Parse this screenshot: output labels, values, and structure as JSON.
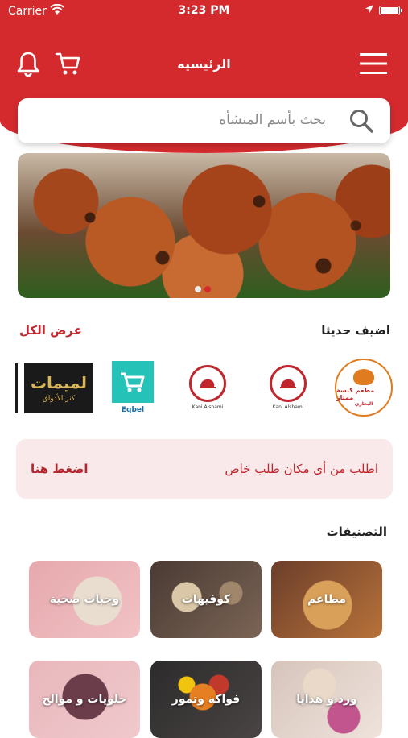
{
  "status_bar": {
    "carrier": "Carrier",
    "time": "3:23 PM"
  },
  "header": {
    "title": "الرئيسيه",
    "icons": [
      "bell-icon",
      "cart-icon",
      "menu-icon"
    ]
  },
  "search": {
    "placeholder": "بحث بأسم المنشأه",
    "icon": "search-icon"
  },
  "banner": {
    "slides": 2,
    "active_slide": 1
  },
  "recently_added": {
    "title": "اضيف حديثا",
    "view_all": "عرض الكل",
    "logos": [
      {
        "name": "kabsa-restaurant",
        "text": "مطعم كبسة ممتاز",
        "subtext": "البخاري"
      },
      {
        "name": "roaster-1",
        "text": "Kani Alshami"
      },
      {
        "name": "roaster-2",
        "text": "Kani Alshami"
      },
      {
        "name": "eqbel",
        "text": "Eqbel"
      },
      {
        "name": "lameemat",
        "text": "لميمات",
        "subtext": "كنز الأذواق"
      }
    ]
  },
  "order_card": {
    "message": "اطلب من أى مكان طلب خاص",
    "action": "اضغط هنا"
  },
  "categories": {
    "title": "التصنيفات",
    "items": [
      {
        "label": "مطاعم"
      },
      {
        "label": "كوفيهات"
      },
      {
        "label": "وجبات صحية"
      },
      {
        "label": "ورد و هدايا"
      },
      {
        "label": "فواكه وتمور"
      },
      {
        "label": "حلويات و موالح"
      }
    ]
  },
  "colors": {
    "primary": "#d42a2e",
    "accent_text": "#c0262c",
    "card_bg": "#f9e9ea"
  }
}
